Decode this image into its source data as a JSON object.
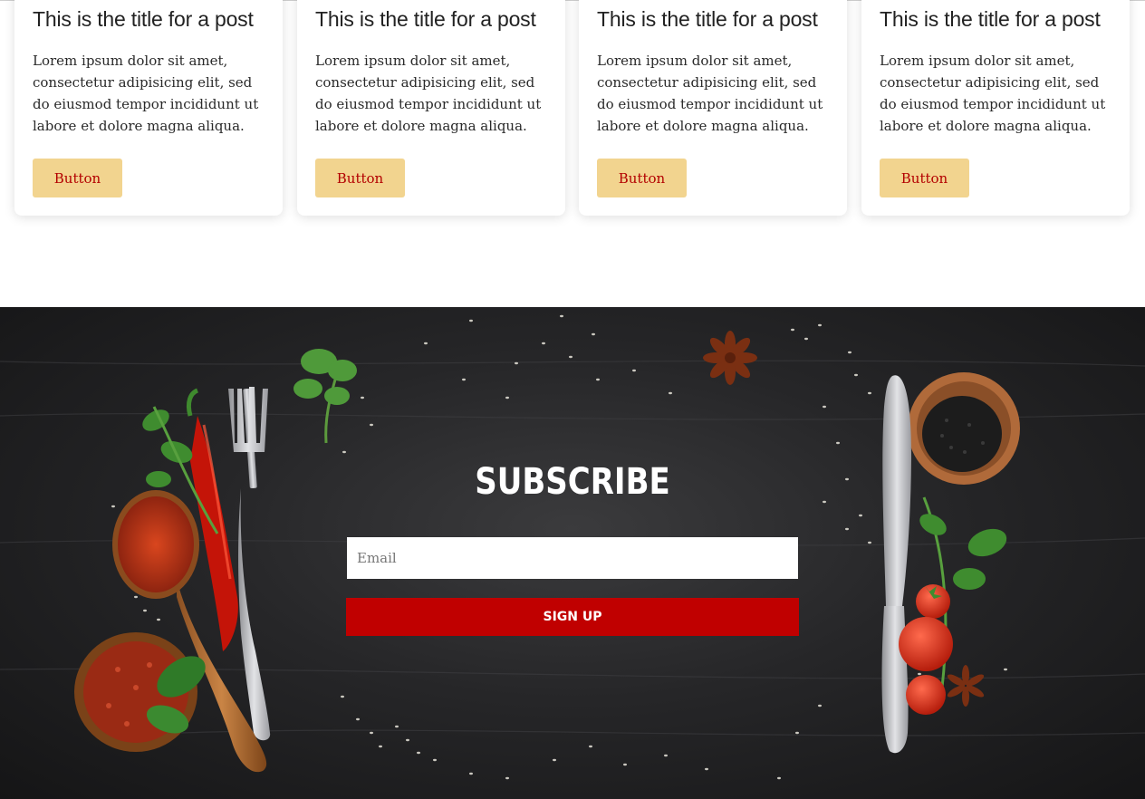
{
  "posts": [
    {
      "title": "This is the title for a post",
      "body": "Lorem ipsum dolor sit amet, consectetur adipisicing elit, sed do eiusmod tempor incididunt ut labore et dolore magna aliqua.",
      "button_label": "Button"
    },
    {
      "title": "This is the title for a post",
      "body": "Lorem ipsum dolor sit amet, consectetur adipisicing elit, sed do eiusmod tempor incididunt ut labore et dolore magna aliqua.",
      "button_label": "Button"
    },
    {
      "title": "This is the title for a post",
      "body": "Lorem ipsum dolor sit amet, consectetur adipisicing elit, sed do eiusmod tempor incididunt ut labore et dolore magna aliqua.",
      "button_label": "Button"
    },
    {
      "title": "This is the title for a post",
      "body": "Lorem ipsum dolor sit amet, consectetur adipisicing elit, sed do eiusmod tempor incididunt ut labore et dolore magna aliqua.",
      "button_label": "Button"
    }
  ],
  "subscribe": {
    "title": "SUBSCRIBE",
    "email_placeholder": "Email",
    "email_value": "",
    "signup_label": "SIGN UP"
  },
  "colors": {
    "card_button_bg": "#f2d48f",
    "card_button_text": "#b30000",
    "signup_bg": "#c00000",
    "section_bg": "#262628"
  },
  "icons": {
    "background": "food-ingredients-background"
  }
}
